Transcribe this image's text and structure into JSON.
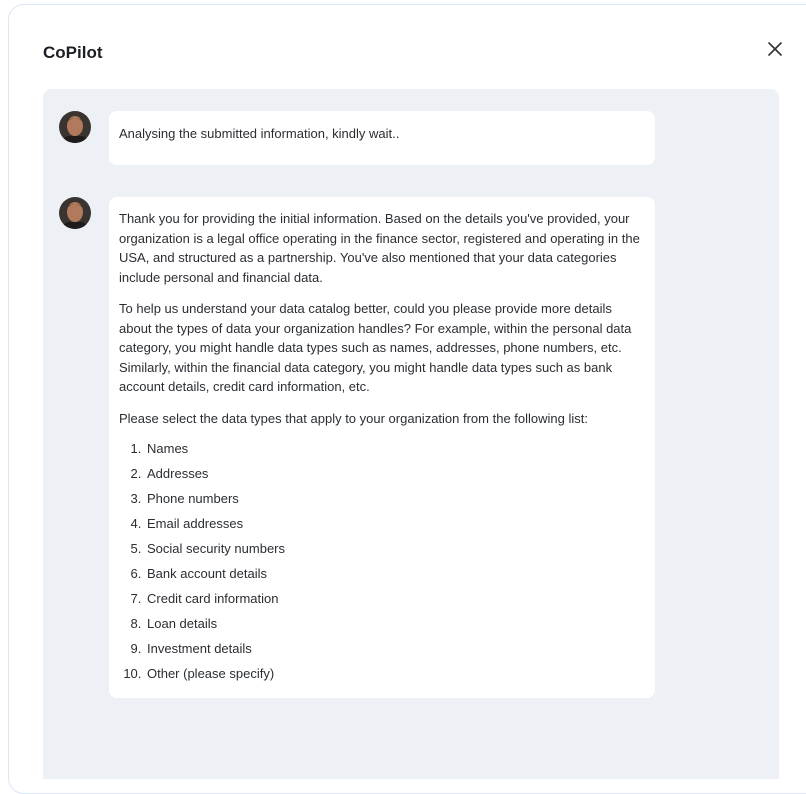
{
  "dialog": {
    "title": "CoPilot"
  },
  "messages": [
    {
      "text": "Analysing the submitted information, kindly wait.."
    },
    {
      "paragraphs": [
        "Thank you for providing the initial information. Based on the details you've provided, your organization is a legal office operating in the finance sector, registered and operating in the USA, and structured as a partnership. You've also mentioned that your data categories include personal and financial data.",
        "To help us understand your data catalog better, could you please provide more details about the types of data your organization handles? For example, within the personal data category, you might handle data types such as names, addresses, phone numbers, etc. Similarly, within the financial data category, you might handle data types such as bank account details, credit card information, etc.",
        "Please select the data types that apply to your organization from the following list:"
      ],
      "list": [
        "Names",
        "Addresses",
        "Phone numbers",
        "Email addresses",
        "Social security numbers",
        "Bank account details",
        "Credit card information",
        "Loan details",
        "Investment details",
        "Other (please specify)"
      ]
    }
  ],
  "icons": {
    "close": "close-icon",
    "avatar": "avatar"
  },
  "colors": {
    "chat_background": "#edf1f5",
    "bubble_background": "#ffffff",
    "modal_border": "#dbe6f5"
  }
}
